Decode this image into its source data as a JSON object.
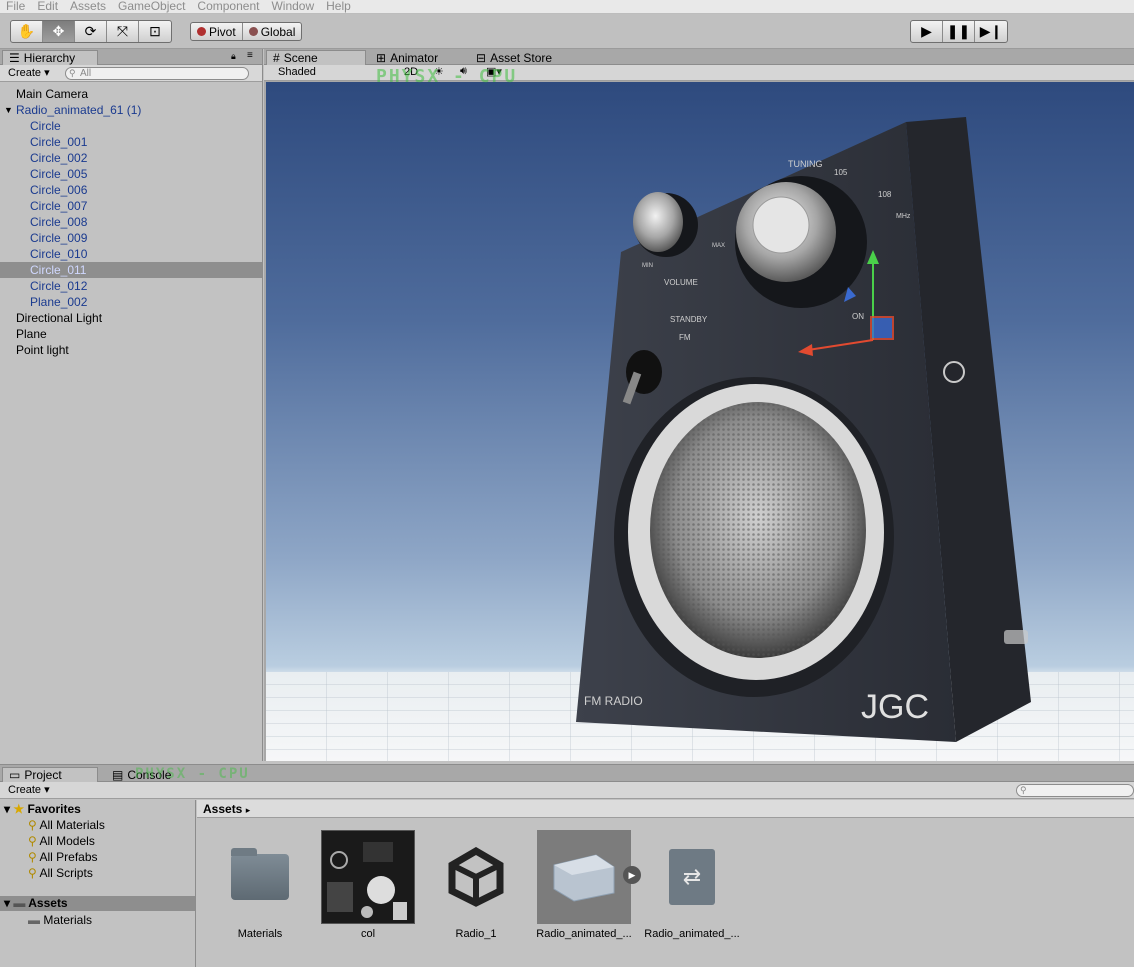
{
  "menu": [
    "File",
    "Edit",
    "Assets",
    "GameObject",
    "Component",
    "Window",
    "Help"
  ],
  "toolbar": {
    "pivot_label": "Pivot",
    "global_label": "Global"
  },
  "hierarchy": {
    "tab_label": "Hierarchy",
    "create_label": "Create",
    "search_placeholder": "All",
    "items": [
      {
        "label": "Main Camera",
        "depth": 0,
        "color": "black"
      },
      {
        "label": "Radio_animated_61 (1)",
        "depth": 0,
        "color": "blue",
        "expanded": true
      },
      {
        "label": "Circle",
        "depth": 1,
        "color": "blue"
      },
      {
        "label": "Circle_001",
        "depth": 1,
        "color": "blue"
      },
      {
        "label": "Circle_002",
        "depth": 1,
        "color": "blue"
      },
      {
        "label": "Circle_005",
        "depth": 1,
        "color": "blue"
      },
      {
        "label": "Circle_006",
        "depth": 1,
        "color": "blue"
      },
      {
        "label": "Circle_007",
        "depth": 1,
        "color": "blue"
      },
      {
        "label": "Circle_008",
        "depth": 1,
        "color": "blue"
      },
      {
        "label": "Circle_009",
        "depth": 1,
        "color": "blue"
      },
      {
        "label": "Circle_010",
        "depth": 1,
        "color": "blue"
      },
      {
        "label": "Circle_011",
        "depth": 1,
        "color": "blue",
        "selected": true
      },
      {
        "label": "Circle_012",
        "depth": 1,
        "color": "blue"
      },
      {
        "label": "Plane_002",
        "depth": 1,
        "color": "blue"
      },
      {
        "label": "Directional Light",
        "depth": 0,
        "color": "black"
      },
      {
        "label": "Plane",
        "depth": 0,
        "color": "black"
      },
      {
        "label": "Point light",
        "depth": 0,
        "color": "black"
      }
    ]
  },
  "scene": {
    "tabs": [
      "Scene",
      "Animator",
      "Asset Store"
    ],
    "shading_mode": "Shaded",
    "mode_2d": "2D",
    "overlay": "PHYSX - CPU",
    "radio_labels": {
      "brand": "JGC",
      "model": "FM RADIO",
      "tuning": "TUNING",
      "volume": "VOLUME",
      "standby": "STANDBY",
      "fm": "FM",
      "on": "ON",
      "min": "MIN",
      "max": "MAX",
      "mhz": "MHz",
      "freq1": "105",
      "freq2": "108"
    }
  },
  "project": {
    "tabs": [
      "Project",
      "Console"
    ],
    "create_label": "Create",
    "favorites_label": "Favorites",
    "favorites": [
      "All Materials",
      "All Models",
      "All Prefabs",
      "All Scripts"
    ],
    "assets_label": "Assets",
    "folders": [
      "Materials"
    ],
    "breadcrumb": "Assets",
    "files": [
      "Materials",
      "col",
      "Radio_1",
      "Radio_animated_...",
      "Radio_animated_..."
    ]
  },
  "colors": {
    "selection_bg": "#8e8e8e",
    "prefab_text": "#1a3a8f",
    "overlay_green": "#3fbf3f"
  }
}
